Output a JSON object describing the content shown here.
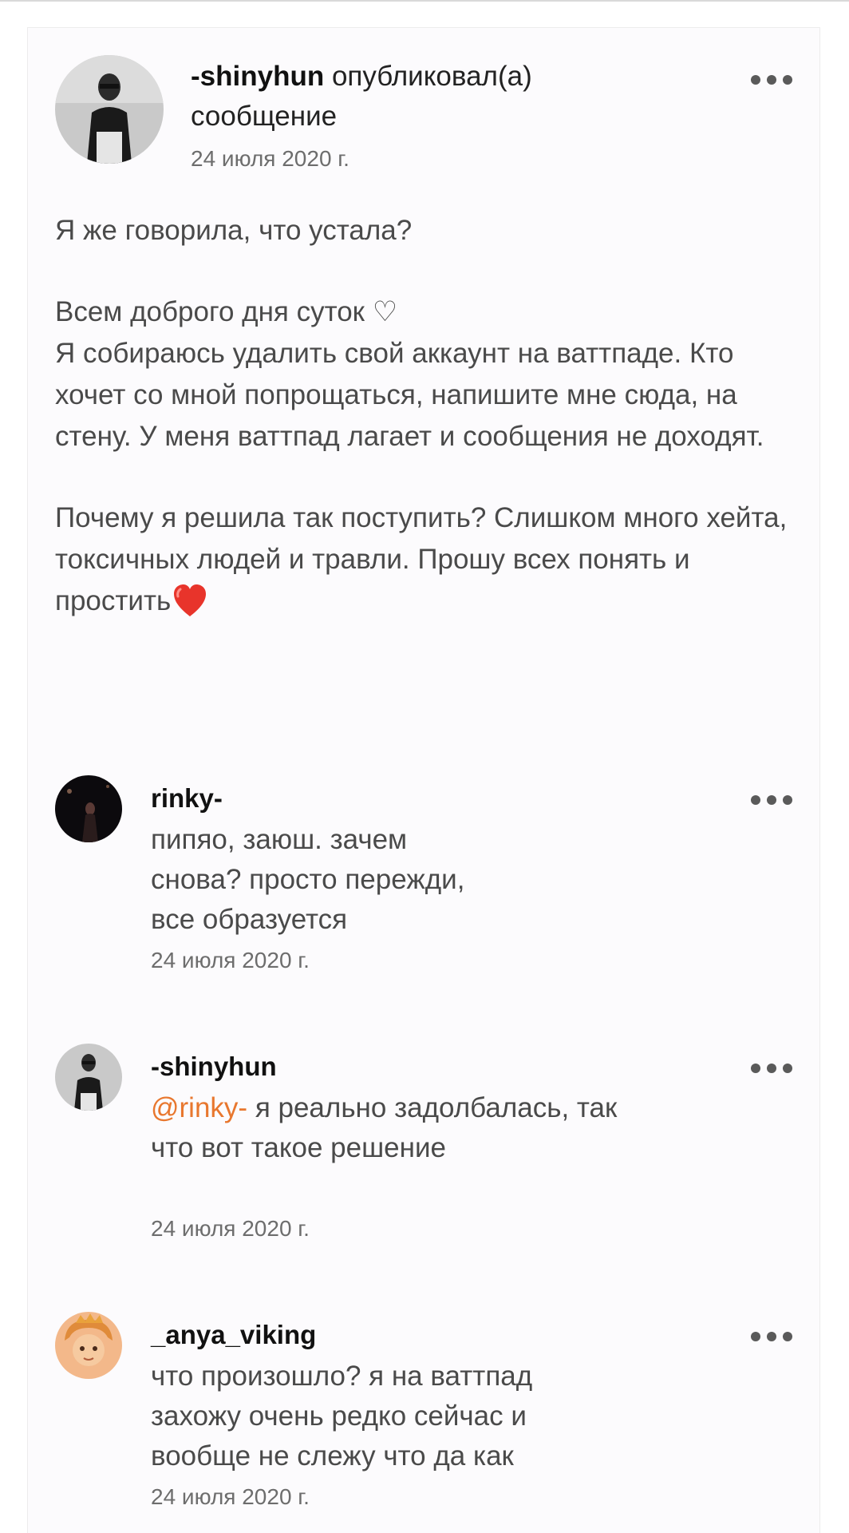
{
  "post": {
    "author": "-shinyhun",
    "action_text": " опубликовал(а) сообщение",
    "date": "24 июля 2020 г.",
    "body": {
      "line1": "Я же говорила, что устала?",
      "line2": "Всем доброго дня суток ♡",
      "line3": "Я собираюсь удалить свой аккаунт на ваттпаде. Кто хочет со мной попрощаться, напишите мне сюда, на стену. У меня ваттпад лагает и сообщения не доходят.",
      "line4": "Почему я решила так поступить? Слишком много хейта, токсичных людей и травли. Прошу всех понять и простить"
    }
  },
  "comments": [
    {
      "author": "rinky-",
      "text": "пипяо, заюш. зачем снова? просто пережди, все образуется",
      "date": "24 июля 2020 г."
    },
    {
      "author": "-shinyhun",
      "mention": "@rinky-",
      "text": " я реально задолбалась, так что вот такое решение",
      "date": "24 июля 2020 г."
    },
    {
      "author": "_anya_viking",
      "text": "что произошло? я на ваттпад захожу очень редко сейчас и вообще не слежу что да как",
      "date": "24 июля 2020 г."
    }
  ],
  "icons": {
    "more": "more-horizontal-icon",
    "heart": "red-heart-emoji"
  },
  "colors": {
    "mention": "#e8772e",
    "heart": "#e8342b",
    "card_bg": "#fcfbfd",
    "dots": "#5a5a5a"
  }
}
